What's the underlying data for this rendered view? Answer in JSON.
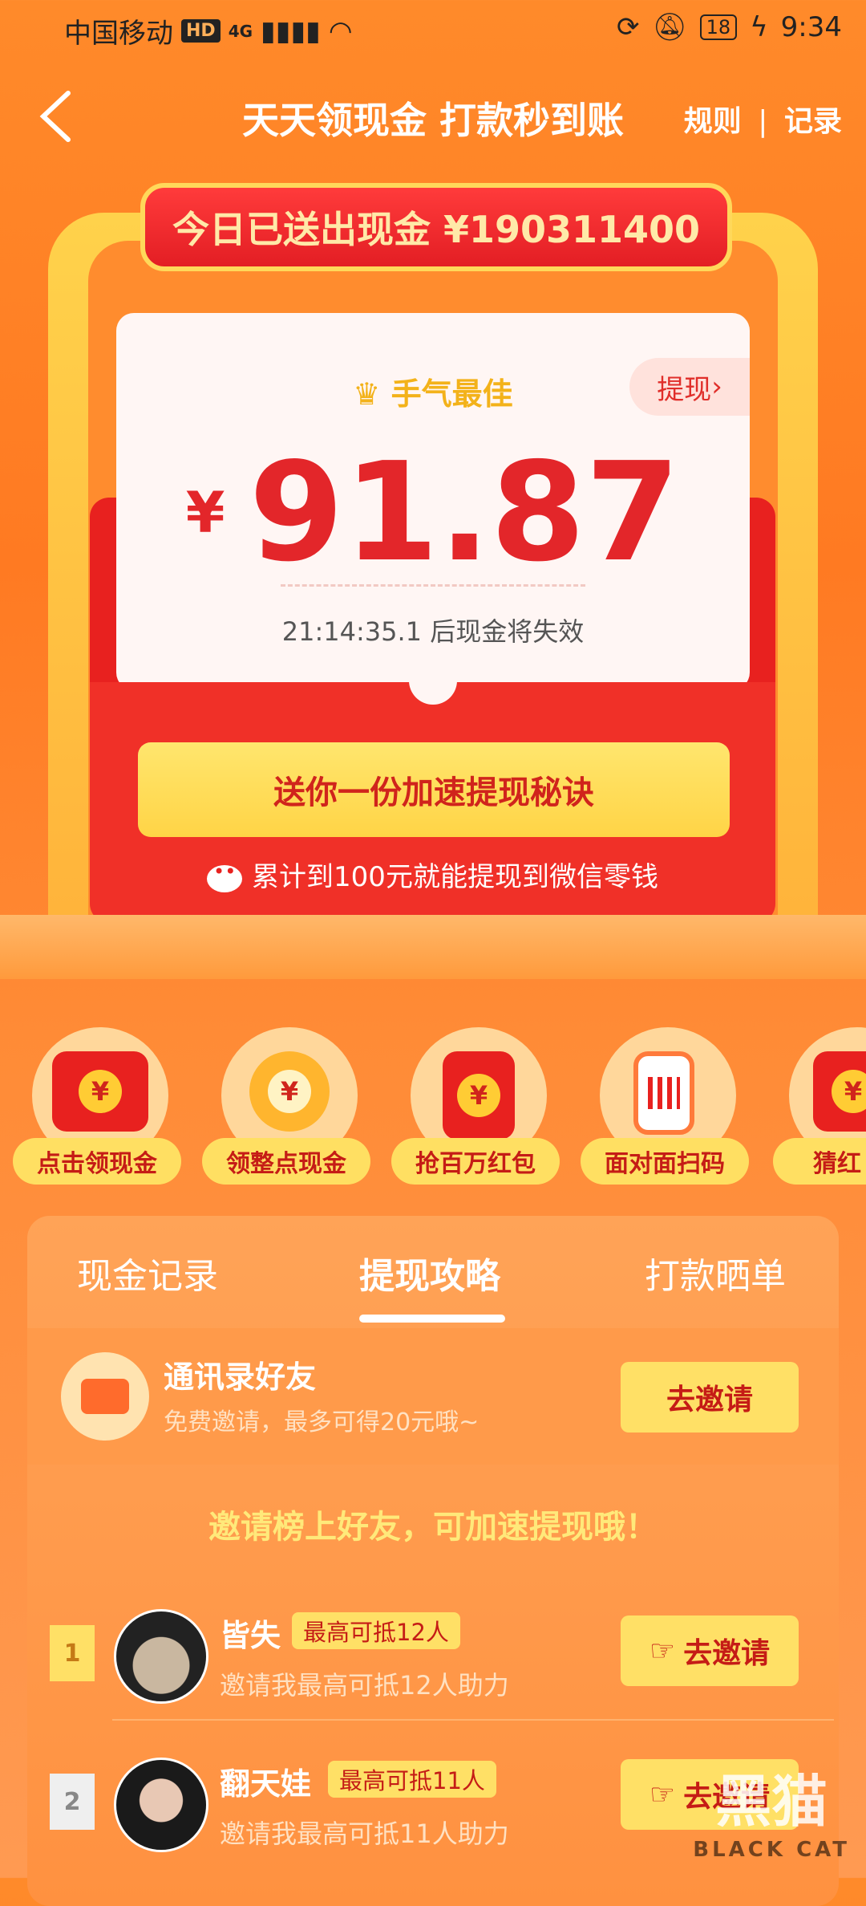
{
  "status_bar": {
    "carrier": "中国移动",
    "hd": "HD",
    "network": "4G",
    "battery": "18",
    "time": "9:34"
  },
  "header": {
    "title": "天天领现金 打款秒到账",
    "rules": "规则",
    "records": "记录",
    "separator": "|"
  },
  "banner": {
    "text": "今日已送出现金 ¥190311400"
  },
  "cash_card": {
    "best_label": "手气最佳",
    "withdraw_label": "提现",
    "currency": "¥",
    "amount": "91.87",
    "expire_text": "21:14:35.1 后现金将失效",
    "speed_button": "送你一份加速提现秘诀",
    "wechat_tip": "累计到100元就能提现到微信零钱"
  },
  "quick_actions": [
    {
      "label": "点击领现金",
      "icon": "red-envelope-coin-icon"
    },
    {
      "label": "领整点现金",
      "icon": "alarm-clock-icon"
    },
    {
      "label": "抢百万红包",
      "icon": "red-packet-icon"
    },
    {
      "label": "面对面扫码",
      "icon": "qr-code-phone-icon"
    },
    {
      "label": "猜红",
      "icon": "red-packet-icon"
    }
  ],
  "tabs": [
    {
      "label": "现金记录"
    },
    {
      "label": "提现攻略"
    },
    {
      "label": "打款晒单"
    }
  ],
  "contacts_row": {
    "title": "通讯录好友",
    "subtitle": "免费邀请，最多可得20元哦~",
    "button": "去邀请"
  },
  "board_title": "邀请榜上好友，可加速提现哦！",
  "friends": [
    {
      "rank": "1",
      "name": "皆失",
      "badge": "最高可抵12人",
      "desc": "邀请我最高可抵12人助力",
      "button": "去邀请"
    },
    {
      "rank": "2",
      "name": "翻天娃",
      "badge": "最高可抵11人",
      "desc": "邀请我最高可抵11人助力",
      "button": "去邀请"
    }
  ],
  "watermark": {
    "cn": "黑猫",
    "en": "BLACK CAT"
  },
  "colors": {
    "primary_orange": "#ff8a2a",
    "red": "#e8211f",
    "yellow": "#ffe066",
    "amount_red": "#e3262a"
  }
}
